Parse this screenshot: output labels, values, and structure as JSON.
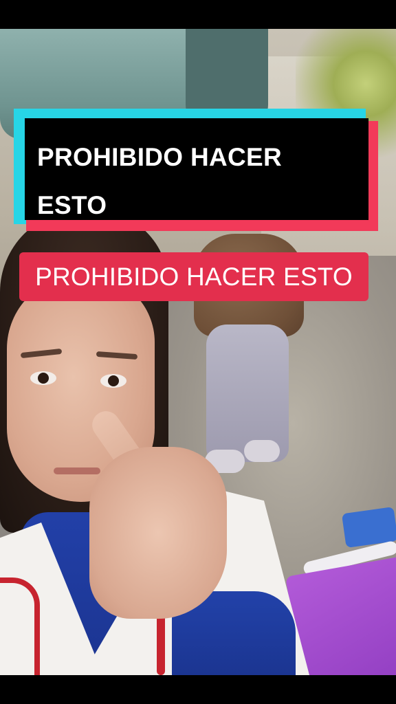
{
  "captions": {
    "primary_line1": "PROHIBIDO HACER",
    "primary_line2": "ESTO",
    "secondary": "PROHIBIDO HACER ESTO"
  },
  "colors": {
    "caption_cyan": "#27d5e6",
    "caption_red": "#f23a59",
    "caption_box": "#000000",
    "label_red": "#e32f4d"
  }
}
